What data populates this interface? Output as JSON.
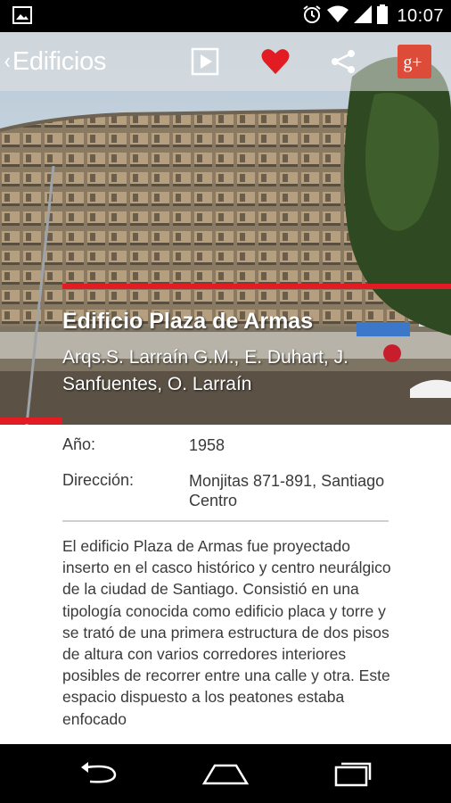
{
  "status_bar": {
    "time": "10:07",
    "icons": [
      "image-notification-icon",
      "alarm-icon",
      "wifi-icon",
      "signal-icon",
      "battery-icon"
    ]
  },
  "action_bar": {
    "back_label": "Edificios",
    "actions": [
      "play-icon",
      "favorite-heart-icon",
      "share-icon",
      "google-plus-icon"
    ],
    "heart_color": "#e31b23",
    "gplus_color": "#dd4b39"
  },
  "hero": {
    "title": "Edificio Plaza de Armas",
    "subtitle": "Arqs.S. Larraín G.M., E. Duhart, J. Sanfuentes, O. Larraín",
    "accent_color": "#e31b23"
  },
  "details": {
    "year_label": "Año:",
    "year_value": "1958",
    "address_label": "Dirección:",
    "address_value": "Monjitas 871-891, Santiago Centro"
  },
  "description": "El edificio Plaza de Armas fue proyectado inserto en el casco  histórico y centro neurálgico de la ciudad de Santiago. Consistió en una tipología conocida como edificio placa y torre y se trató de una primera estructura de dos pisos de altura con varios corredores interiores posibles de recorrer entre una calle y otra. Este espacio dispuesto a los peatones estaba enfocado",
  "nav_bar": {
    "buttons": [
      "back-nav-icon",
      "home-nav-icon",
      "recents-nav-icon"
    ]
  }
}
